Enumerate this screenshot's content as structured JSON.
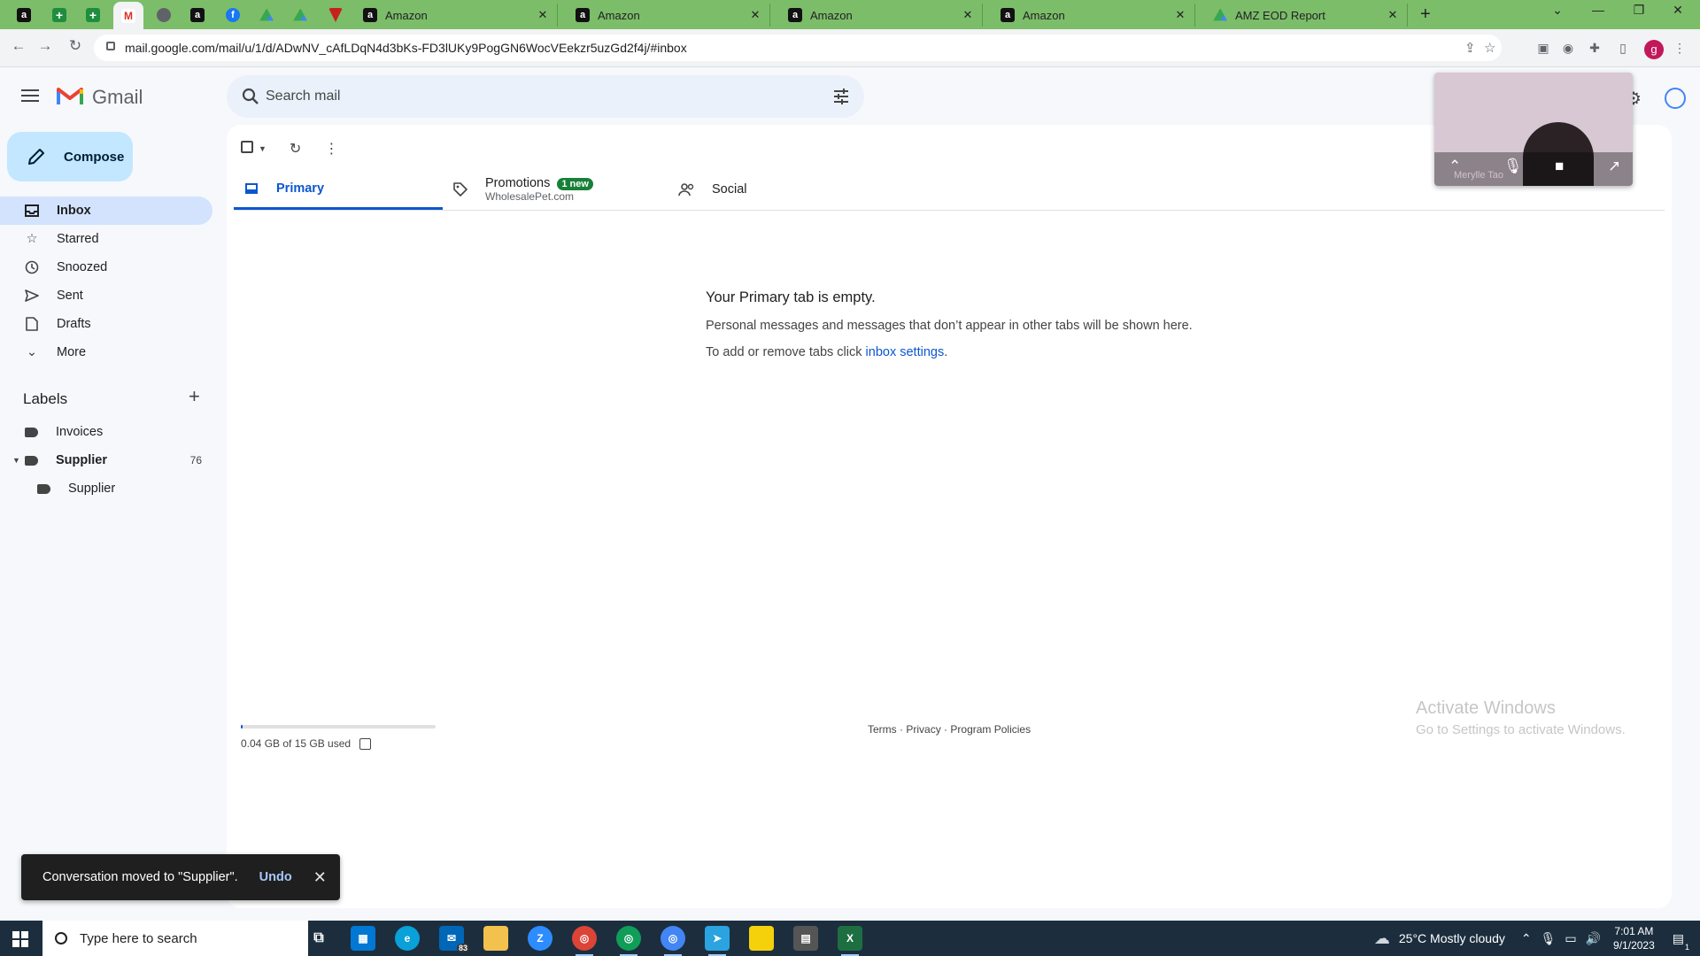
{
  "browser": {
    "tabs": [
      {
        "title": "Amazon"
      },
      {
        "title": "Amazon"
      },
      {
        "title": "Amazon"
      },
      {
        "title": "Amazon"
      },
      {
        "title": "AMZ EOD Report"
      }
    ],
    "url": "mail.google.com/mail/u/1/d/ADwNV_cAfLDqN4d3bKs-FD3lUKy9PogGN6WocVEekzr5uzGd2f4j/#inbox",
    "profile_initial": "g",
    "theme_color": "#7cbd69"
  },
  "gmail": {
    "app_name": "Gmail",
    "search_placeholder": "Search mail",
    "compose_label": "Compose",
    "nav": [
      {
        "label": "Inbox",
        "icon": "inbox-icon"
      },
      {
        "label": "Starred",
        "icon": "star-icon"
      },
      {
        "label": "Snoozed",
        "icon": "clock-icon"
      },
      {
        "label": "Sent",
        "icon": "send-icon"
      },
      {
        "label": "Drafts",
        "icon": "draft-icon"
      },
      {
        "label": "More",
        "icon": "chevron-down-icon"
      }
    ],
    "labels_title": "Labels",
    "labels": [
      {
        "name": "Invoices"
      },
      {
        "name": "Supplier",
        "count": "76"
      },
      {
        "name": "Supplier"
      }
    ],
    "tabs": [
      {
        "label": "Primary"
      },
      {
        "label": "Promotions",
        "badge": "1 new",
        "subtitle": "WholesalePet.com"
      },
      {
        "label": "Social"
      }
    ],
    "empty_state": {
      "title": "Your Primary tab is empty.",
      "description": "Personal messages and messages that don’t appear in other tabs will be shown here.",
      "hint_prefix": "To add or remove tabs click ",
      "hint_link": "inbox settings",
      "hint_suffix": "."
    },
    "storage": {
      "text": "0.04 GB of 15 GB used",
      "fraction": 0.003
    },
    "footer_links": [
      "Terms",
      "·",
      "Privacy",
      "·",
      "Program Policies"
    ],
    "snackbar": {
      "message": "Conversation moved to \"Supplier\".",
      "action": "Undo"
    },
    "video_tile": {
      "name": "Merylle Tao"
    },
    "accent_color": "#0b57d0",
    "promotions_badge_color": "#188038"
  },
  "watermark": {
    "line1": "Activate Windows",
    "line2": "Go to Settings to activate Windows."
  },
  "taskbar": {
    "search_placeholder": "Type here to search",
    "mail_badge": "83",
    "weather": "25°C  Mostly cloudy",
    "time": "7:01 AM",
    "date": "9/1/2023",
    "notification_count": "1"
  }
}
